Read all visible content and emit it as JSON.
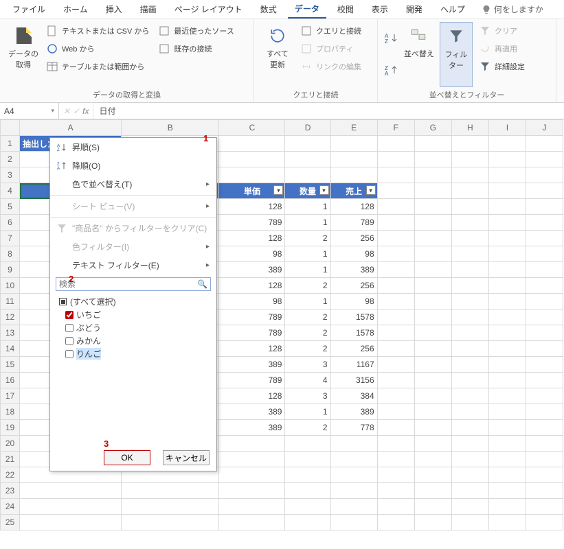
{
  "menubar": {
    "tabs": [
      "ファイル",
      "ホーム",
      "挿入",
      "描画",
      "ページ レイアウト",
      "数式",
      "データ",
      "校閲",
      "表示",
      "開発",
      "ヘルプ"
    ],
    "active_index": 6,
    "search_hint": "何をしますか"
  },
  "ribbon": {
    "group1": {
      "big": "データの\n取得",
      "items": [
        "テキストまたは CSV から",
        "Web から",
        "テーブルまたは範囲から",
        "最近使ったソース",
        "既存の接続"
      ],
      "label": "データの取得と変換"
    },
    "group2": {
      "big": "すべて\n更新",
      "items": [
        "クエリと接続",
        "プロパティ",
        "リンクの編集"
      ],
      "label": "クエリと接続"
    },
    "group3": {
      "sort": "並べ替え",
      "filter": "フィルター",
      "items": [
        "クリア",
        "再適用",
        "詳細設定"
      ],
      "label": "並べ替えとフィルター"
    }
  },
  "namebox": "A4",
  "formula": "日付",
  "columns": [
    "A",
    "B",
    "C",
    "D",
    "E",
    "F",
    "G",
    "H",
    "I",
    "J"
  ],
  "title_cell": "抽出した売上の合計",
  "table": {
    "headers": [
      "日付",
      "商品名",
      "単価",
      "数量",
      "売上"
    ],
    "rows": [
      {
        "c": 128,
        "d": 1,
        "e": 128
      },
      {
        "c": 789,
        "d": 1,
        "e": 789
      },
      {
        "c": 128,
        "d": 2,
        "e": 256
      },
      {
        "c": 98,
        "d": 1,
        "e": 98
      },
      {
        "c": 389,
        "d": 1,
        "e": 389
      },
      {
        "c": 128,
        "d": 2,
        "e": 256
      },
      {
        "c": 98,
        "d": 1,
        "e": 98
      },
      {
        "c": 789,
        "d": 2,
        "e": 1578
      },
      {
        "c": 789,
        "d": 2,
        "e": 1578
      },
      {
        "c": 128,
        "d": 2,
        "e": 256
      },
      {
        "c": 389,
        "d": 3,
        "e": 1167
      },
      {
        "c": 789,
        "d": 4,
        "e": 3156
      },
      {
        "c": 128,
        "d": 3,
        "e": 384
      },
      {
        "c": 389,
        "d": 1,
        "e": 389
      },
      {
        "c": 389,
        "d": 2,
        "e": 778
      }
    ]
  },
  "filter_dd": {
    "sort_asc": "昇順(S)",
    "sort_desc": "降順(O)",
    "sort_color": "色で並べ替え(T)",
    "sheet_view": "シート ビュー(V)",
    "clear_filter": "\"商品名\" からフィルターをクリア(C)",
    "color_filter": "色フィルター(I)",
    "text_filter": "テキスト フィルター(E)",
    "search_ph": "検索",
    "all": "(すべて選択)",
    "items": [
      "いちご",
      "ぶどう",
      "みかん",
      "りんご"
    ],
    "checked_index": 0,
    "selected_index": 3,
    "ok": "OK",
    "cancel": "キャンセル"
  },
  "markers": {
    "m1": "1",
    "m2": "2",
    "m3": "3"
  }
}
